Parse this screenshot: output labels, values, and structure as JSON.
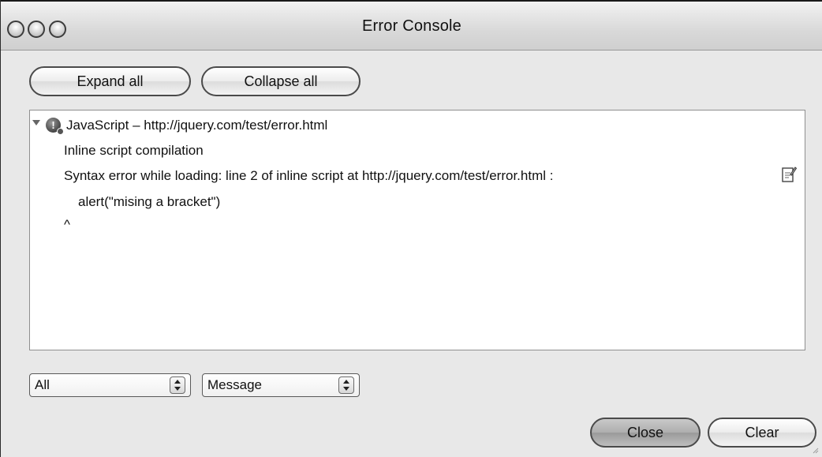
{
  "window": {
    "title": "Error Console"
  },
  "toolbar": {
    "expand_label": "Expand all",
    "collapse_label": "Collapse all"
  },
  "console": {
    "entry_header": "JavaScript – http://jquery.com/test/error.html",
    "lines": [
      "Inline script compilation",
      "Syntax error while loading: line 2 of inline script at http://jquery.com/test/error.html :",
      "alert(\"mising a bracket\")",
      "^"
    ]
  },
  "filters": {
    "type_value": "All",
    "field_value": "Message"
  },
  "footer": {
    "close_label": "Close",
    "clear_label": "Clear"
  }
}
